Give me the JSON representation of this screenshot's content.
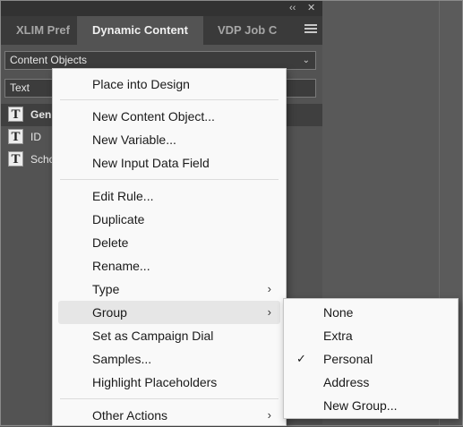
{
  "panel": {
    "titlebar": {
      "collapse_icon": "double-chevron-icon",
      "collapse_glyph": "‹‹",
      "close_glyph": "✕"
    },
    "tabs": [
      {
        "label": "XLIM Pref"
      },
      {
        "label": "Dynamic Content",
        "active": true
      },
      {
        "label": "VDP Job C"
      }
    ],
    "dropdown": {
      "value": "Content Objects"
    },
    "filter": {
      "value": "Text"
    },
    "items": [
      {
        "label": "Gen"
      },
      {
        "label": "ID"
      },
      {
        "label": "Scho"
      }
    ],
    "item_icon_glyph": "T"
  },
  "context_menu": {
    "items": [
      {
        "label": "Place into Design"
      },
      {
        "label": "New Content Object..."
      },
      {
        "label": "New Variable..."
      },
      {
        "label": "New Input Data Field"
      },
      {
        "label": "Edit Rule..."
      },
      {
        "label": "Duplicate"
      },
      {
        "label": "Delete"
      },
      {
        "label": "Rename..."
      },
      {
        "label": "Type"
      },
      {
        "label": "Group"
      },
      {
        "label": "Set as Campaign Dial"
      },
      {
        "label": "Samples..."
      },
      {
        "label": "Highlight Placeholders"
      },
      {
        "label": "Other Actions"
      }
    ],
    "arrow_glyph": "›"
  },
  "group_submenu": {
    "items": [
      {
        "label": "None"
      },
      {
        "label": "Extra"
      },
      {
        "label": "Personal",
        "checked": true
      },
      {
        "label": "Address"
      },
      {
        "label": "New Group..."
      }
    ],
    "check_glyph": "✓"
  }
}
